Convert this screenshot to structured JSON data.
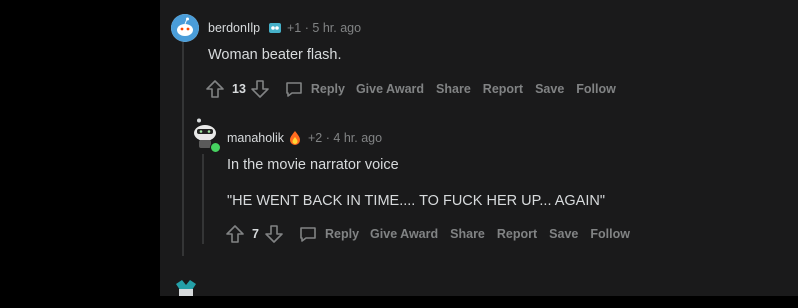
{
  "comments": [
    {
      "username": "berdonIlp",
      "karma": "+1",
      "time": "5 hr. ago",
      "body": [
        "Woman beater flash."
      ],
      "votes": "13",
      "actions": {
        "reply": "Reply",
        "give_award": "Give Award",
        "share": "Share",
        "report": "Report",
        "save": "Save",
        "follow": "Follow"
      }
    },
    {
      "username": "manaholik",
      "karma": "+2",
      "time": "4 hr. ago",
      "body": [
        "In the movie narrator voice",
        "\"HE WENT BACK IN TIME.... TO FUCK HER UP... AGAIN\""
      ],
      "votes": "7",
      "actions": {
        "reply": "Reply",
        "give_award": "Give Award",
        "share": "Share",
        "report": "Report",
        "save": "Save",
        "follow": "Follow"
      }
    }
  ],
  "separator": "·",
  "colors": {
    "background": "#1a1a1b",
    "outer": "#000000",
    "text": "#d7dadc",
    "muted": "#818384",
    "online": "#46d160"
  }
}
